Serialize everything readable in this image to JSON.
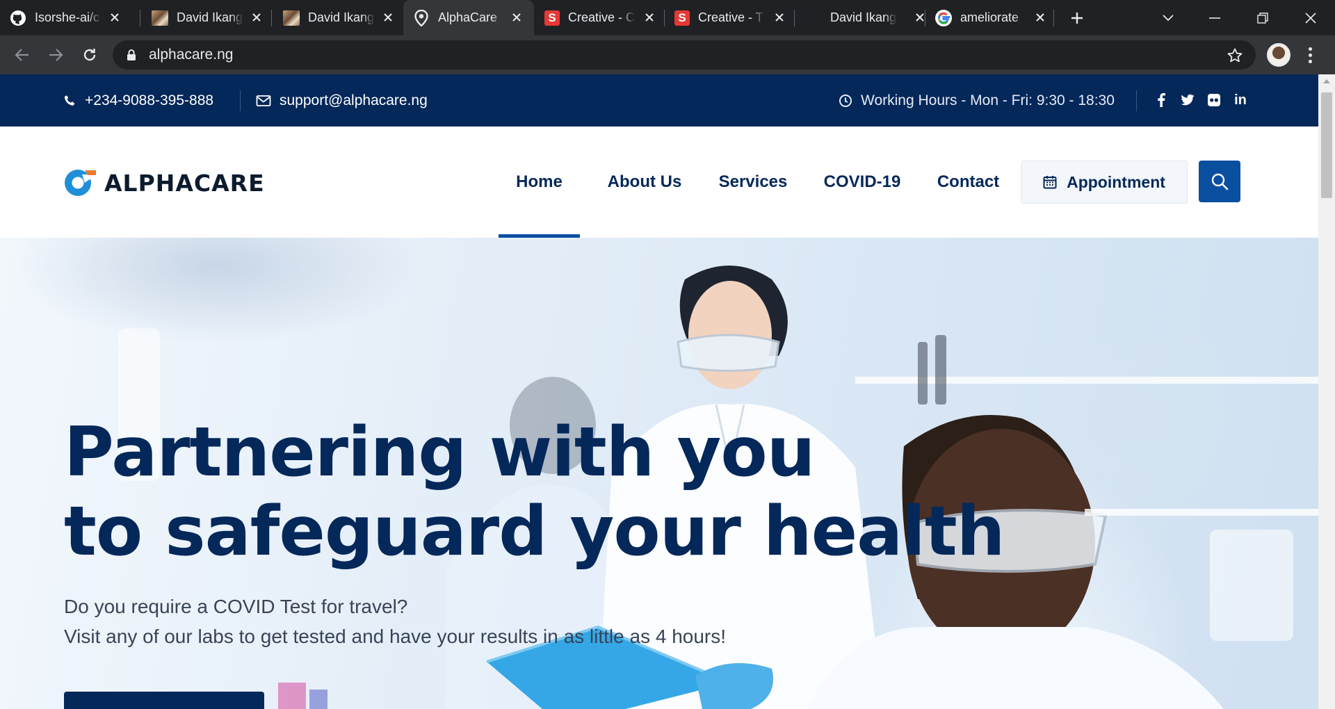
{
  "browser": {
    "tabs": [
      {
        "title": "Isorshe-ai/c",
        "icon": "github-icon",
        "active": false
      },
      {
        "title": "David Ikang",
        "icon": "photo-favicon",
        "active": false
      },
      {
        "title": "David Ikang",
        "icon": "photo-favicon",
        "active": false
      },
      {
        "title": "AlphaCare",
        "icon": "location-pin-icon",
        "active": true
      },
      {
        "title": "Creative - C",
        "icon": "s-favicon",
        "active": false
      },
      {
        "title": "Creative - T",
        "icon": "s-favicon",
        "active": false
      },
      {
        "title": "David Ikang",
        "icon": "none",
        "active": false
      },
      {
        "title": "ameliorate",
        "icon": "google-icon",
        "active": false
      }
    ],
    "url": "alphacare.ng"
  },
  "topbar": {
    "phone": "+234-9088-395-888",
    "email": "support@alphacare.ng",
    "hours": "Working Hours - Mon - Fri: 9:30 - 18:30",
    "social": [
      "facebook-icon",
      "twitter-icon",
      "flickr-icon",
      "linkedin-icon"
    ],
    "linkedin_text": "in",
    "background": "#05285a"
  },
  "header": {
    "logo_text": "ALPHACARE",
    "nav": [
      "Home",
      "About Us",
      "Services",
      "COVID-19",
      "Contact"
    ],
    "active_nav": "Home",
    "appointment_label": "Appointment",
    "accent": "#0a4ea0"
  },
  "hero": {
    "title_line1": "Partnering with you",
    "title_line2": "to safeguard your health",
    "sub_line1": "Do you require a COVID Test for travel?",
    "sub_line2": "Visit any of our labs to get tested and have your results in as little as 4 hours!",
    "title_color": "#05285a"
  }
}
